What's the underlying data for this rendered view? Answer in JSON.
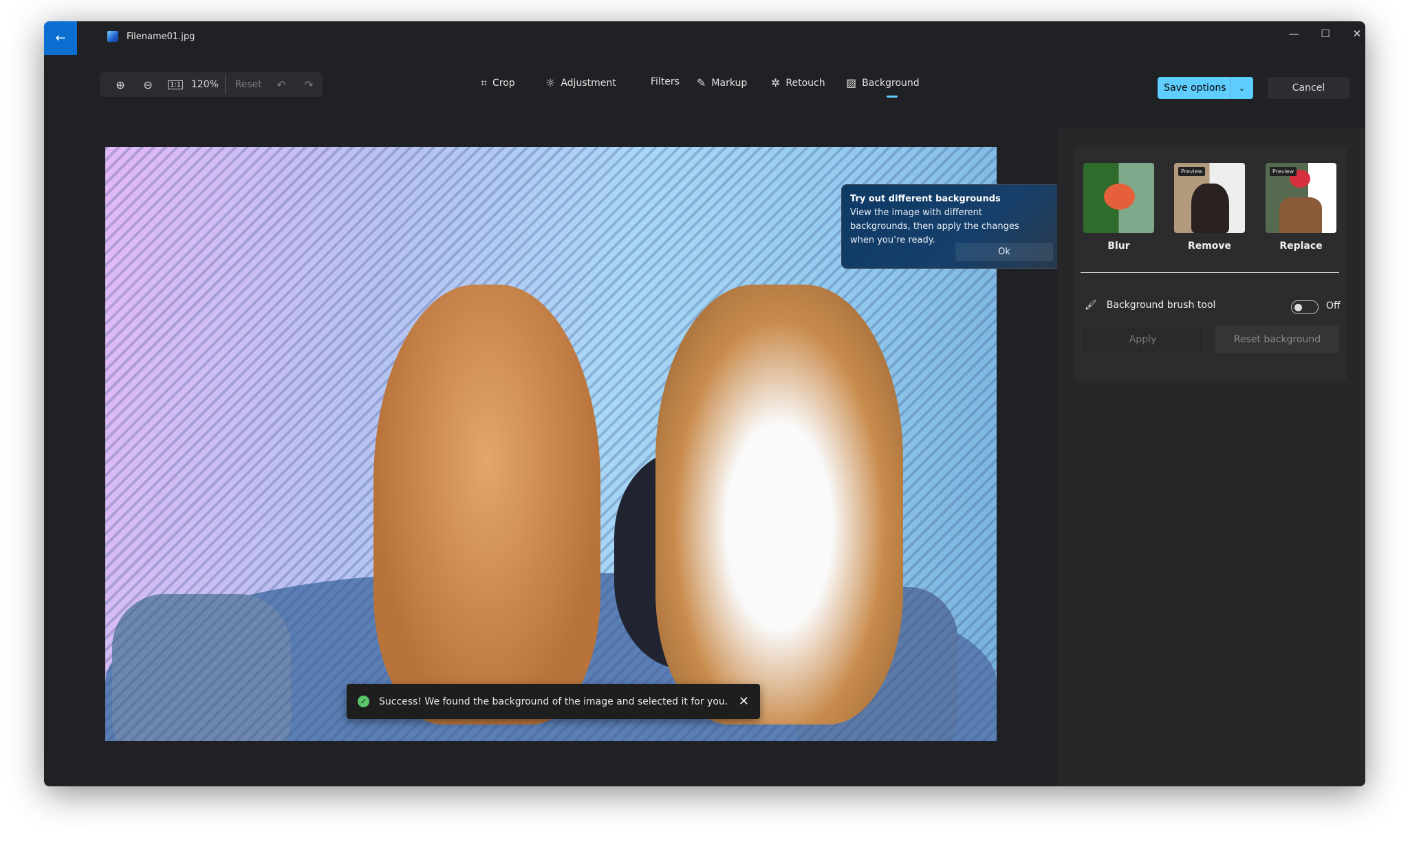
{
  "window": {
    "title": "Filename01.jpg",
    "back_icon": "arrow-left-icon",
    "controls": [
      "minimize-icon",
      "maximize-icon",
      "close-icon"
    ]
  },
  "zoombar": {
    "zoom_in_icon": "zoom-in-icon",
    "zoom_out_icon": "zoom-out-icon",
    "actual_size_label": "1:1",
    "zoom_level": "120%",
    "reset_label": "Reset",
    "undo_icon": "undo-icon",
    "redo_icon": "redo-icon"
  },
  "tools": [
    {
      "label": "Crop",
      "icon": "crop-icon"
    },
    {
      "label": "Adjustment",
      "icon": "brightness-icon"
    },
    {
      "label": "Filters",
      "icon": ""
    },
    {
      "label": "Markup",
      "icon": "pen-icon"
    },
    {
      "label": "Retouch",
      "icon": "retouch-icon"
    },
    {
      "label": "Background",
      "icon": "background-icon",
      "active": true
    }
  ],
  "actions": {
    "save_label": "Save options",
    "cancel_label": "Cancel"
  },
  "colors": {
    "accent": "#60cdff",
    "back_button": "#0a6fd1",
    "success": "#5cc76a"
  },
  "tooltip": {
    "title": "Try out different backgrounds",
    "body": "View the image with different backgrounds, then apply the changes when you’re ready.",
    "ok_label": "Ok"
  },
  "toast": {
    "message": "Success! We found the background of the image and selected it for you."
  },
  "panel": {
    "options": [
      {
        "label": "Blur",
        "badge": ""
      },
      {
        "label": "Remove",
        "badge": "Preview"
      },
      {
        "label": "Replace",
        "badge": "Preview"
      }
    ],
    "brush_label": "Background brush tool",
    "brush_state": "Off",
    "apply_label": "Apply",
    "reset_label": "Reset background"
  }
}
